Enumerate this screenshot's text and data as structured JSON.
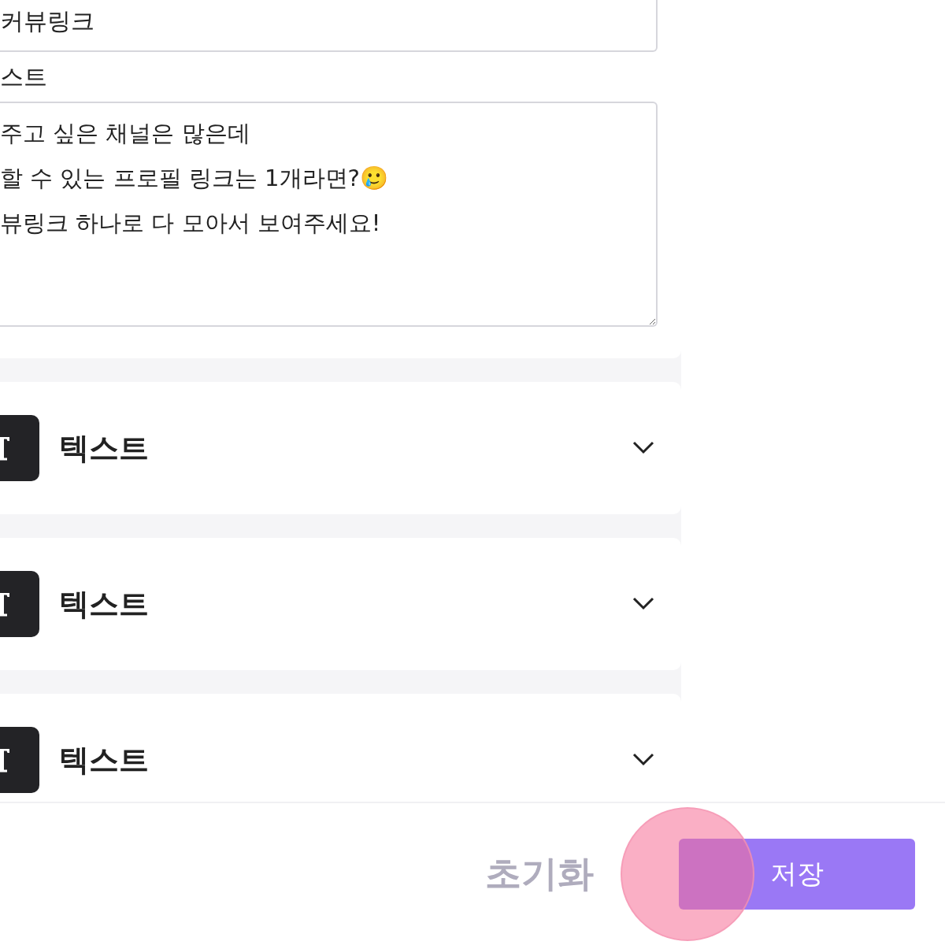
{
  "form": {
    "name_field": {
      "value": "커뷰링크"
    },
    "description_label": "스트",
    "description_field": {
      "value": "주고 싶은 채널은 많은데\n할 수 있는 프로필 링크는 1개라면?🥲\n뷰링크 하나로 다 모아서 보여주세요!"
    }
  },
  "blocks": [
    {
      "title": "텍스트",
      "expanded": false
    },
    {
      "title": "텍스트",
      "expanded": false
    },
    {
      "title": "텍스트",
      "expanded": false
    }
  ],
  "footer": {
    "reset_button": "초기화",
    "save_button": "저장"
  }
}
